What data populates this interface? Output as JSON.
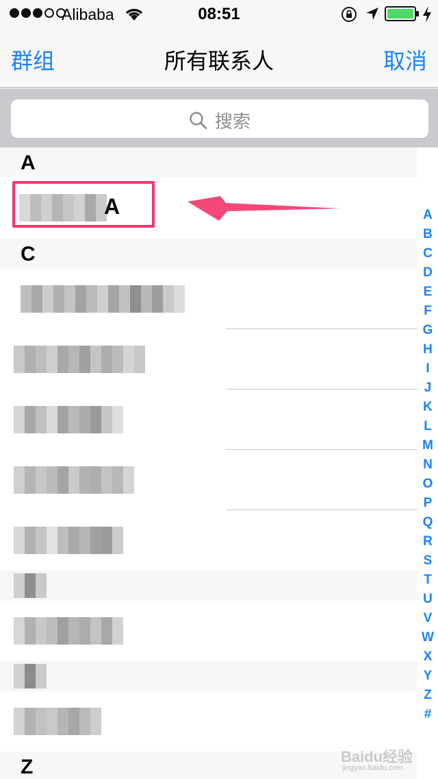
{
  "status_bar": {
    "carrier": "Alibaba",
    "time": "08:51"
  },
  "nav": {
    "left_label": "群组",
    "title": "所有联系人",
    "right_label": "取消"
  },
  "search": {
    "placeholder": "搜索"
  },
  "sections": [
    {
      "letter": "A",
      "contacts": [
        {
          "name_suffix": "A"
        }
      ]
    },
    {
      "letter": "C"
    },
    {
      "letter": "Z"
    }
  ],
  "index_letters": [
    "A",
    "B",
    "C",
    "D",
    "E",
    "F",
    "G",
    "H",
    "I",
    "J",
    "K",
    "L",
    "M",
    "N",
    "O",
    "P",
    "Q",
    "R",
    "S",
    "T",
    "U",
    "V",
    "W",
    "X",
    "Y",
    "Z",
    "#"
  ],
  "colors": {
    "accent": "#1a82fb",
    "highlight": "#f2386e"
  },
  "watermark": {
    "brand": "Baidu经验",
    "url": "jingyan.baidu.com"
  }
}
